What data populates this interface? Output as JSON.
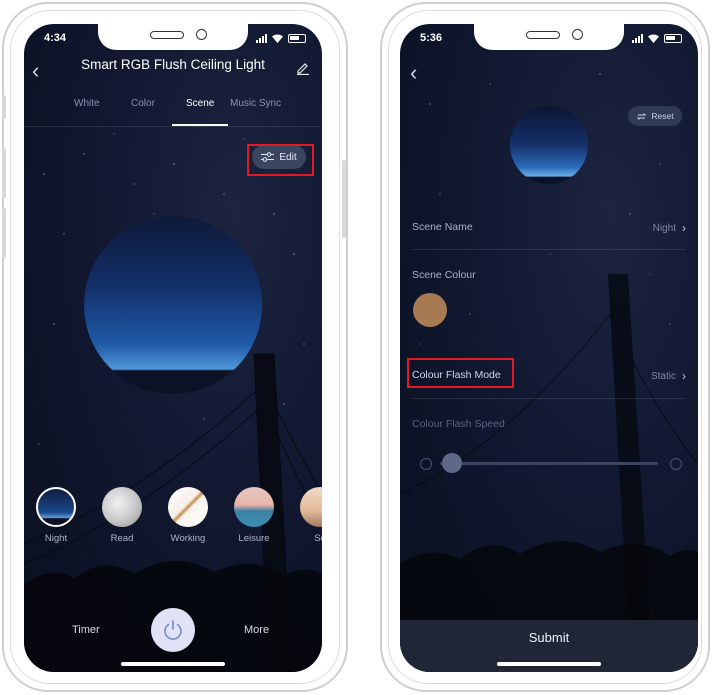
{
  "left": {
    "status": {
      "time": "4:34"
    },
    "title": "Smart RGB Flush Ceiling Light",
    "tabs": [
      {
        "label": "White"
      },
      {
        "label": "Color"
      },
      {
        "label": "Scene",
        "active": true
      },
      {
        "label": "Music Sync"
      }
    ],
    "edit_label": "Edit",
    "scenes": [
      {
        "label": "Night",
        "selected": true
      },
      {
        "label": "Read"
      },
      {
        "label": "Working"
      },
      {
        "label": "Leisure"
      },
      {
        "label": "Se"
      }
    ],
    "bottom": {
      "timer_label": "Timer",
      "more_label": "More"
    },
    "icons": [
      "back-icon",
      "pencil-icon",
      "edit-sliders-icon",
      "power-icon"
    ]
  },
  "right": {
    "status": {
      "time": "5:36"
    },
    "reset_label": "Reset",
    "rows": {
      "scene_name": {
        "label": "Scene Name",
        "value": "Night"
      },
      "scene_colour": {
        "label": "Scene Colour",
        "color": "#a87a52"
      },
      "flash_mode": {
        "label": "Colour Flash Mode",
        "value": "Static"
      },
      "flash_speed": {
        "label": "Colour Flash Speed"
      }
    },
    "submit_label": "Submit",
    "icons": [
      "back-icon",
      "reset-icon",
      "chevron-right-icon",
      "slow-speed-icon",
      "fast-speed-icon"
    ]
  },
  "colors": {
    "highlight": "#e01b24",
    "background": "#111830"
  }
}
